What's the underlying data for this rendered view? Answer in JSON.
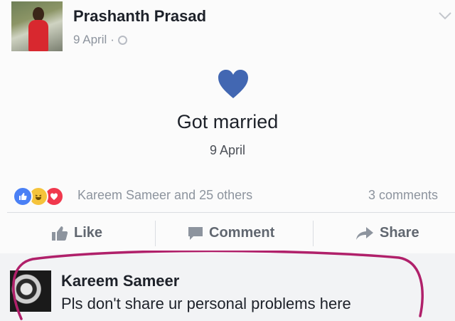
{
  "post": {
    "author_name": "Prashanth Prasad",
    "date": "9 April",
    "separator": "·",
    "privacy_icon": "globe-icon",
    "menu_icon": "chevron-down-icon"
  },
  "life_event": {
    "icon": "heart-icon",
    "title": "Got married",
    "date": "9 April",
    "heart_color": "#4267b2"
  },
  "reactions": {
    "icons": [
      "like-icon",
      "haha-icon",
      "love-icon"
    ],
    "summary": "Kareem Sameer and 25 others",
    "comments": "3 comments"
  },
  "actions": {
    "like_label": "Like",
    "comment_label": "Comment",
    "share_label": "Share"
  },
  "comment": {
    "author": "Kareem Sameer",
    "text": "Pls don't share ur personal problems here",
    "highlight_color": "#b0206a"
  }
}
